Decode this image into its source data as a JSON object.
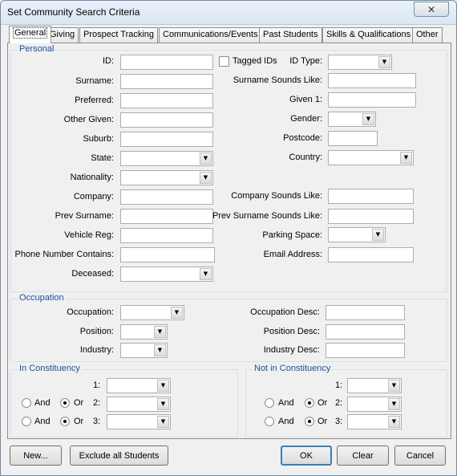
{
  "window": {
    "title": "Set Community Search Criteria"
  },
  "tabs": [
    "General",
    "Giving",
    "Prospect Tracking",
    "Communications/Events",
    "Past Students",
    "Skills & Qualifications",
    "Other"
  ],
  "personal": {
    "title": "Personal",
    "left_labels": [
      "ID:",
      "Surname:",
      "Preferred:",
      "Other Given:",
      "Suburb:",
      "State:",
      "Nationality:",
      "Company:",
      "Prev Surname:",
      "Vehicle Reg:",
      "Phone Number Contains:",
      "Deceased:"
    ],
    "tagged_ids": "Tagged IDs",
    "right_labels": [
      "ID Type:",
      "Surname Sounds Like:",
      "Given 1:",
      "Gender:",
      "Postcode:",
      "Country:",
      "Company Sounds Like:",
      "Prev Surname Sounds Like:",
      "Parking Space:",
      "Email Address:"
    ]
  },
  "occupation": {
    "title": "Occupation",
    "left_labels": [
      "Occupation:",
      "Position:",
      "Industry:"
    ],
    "right_labels": [
      "Occupation Desc:",
      "Position Desc:",
      "Industry Desc:"
    ]
  },
  "in_constituency": {
    "title": "In Constituency",
    "row_labels": [
      "1:",
      "2:",
      "3:"
    ],
    "and_label": "And",
    "or_label": "Or"
  },
  "not_in_constituency": {
    "title": "Not in Constituency",
    "row_labels": [
      "1:",
      "2:",
      "3:"
    ],
    "and_label": "And",
    "or_label": "Or"
  },
  "buttons": {
    "new": "New...",
    "exclude": "Exclude all Students",
    "ok": "OK",
    "clear": "Clear",
    "cancel": "Cancel"
  }
}
